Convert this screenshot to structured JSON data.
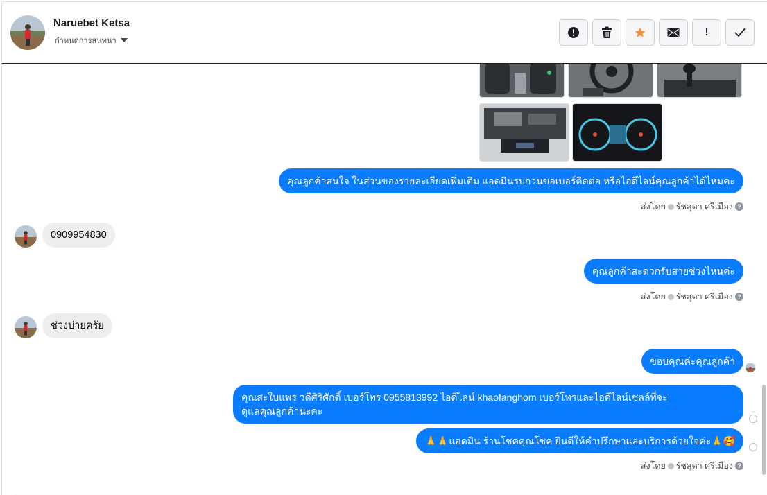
{
  "header": {
    "contact_name": "Naruebet Ketsa",
    "assign_label": "กำหนดการสนทนา",
    "toolbar": [
      {
        "name": "spam-button",
        "icon": "alert-circle-icon"
      },
      {
        "name": "delete-button",
        "icon": "trash-icon"
      },
      {
        "name": "star-button",
        "icon": "star-icon"
      },
      {
        "name": "mark-unread-button",
        "icon": "envelope-icon"
      },
      {
        "name": "follow-up-button",
        "icon": "exclamation-icon",
        "text": "!"
      },
      {
        "name": "mark-done-button",
        "icon": "checkmark-icon"
      }
    ]
  },
  "messages": {
    "m1": "คุณลูกค้าสนใจ ในส่วนของรายละเอียดเพิ่มเติม แอดมินรบกวนขอเบอร์ติดต่อ หรือไอดีไลน์คุณลูกค้าได้ไหมคะ",
    "m2": "0909954830",
    "m3": "คุณลูกค้าสะดวกรับสายช่วงไหนค่ะ",
    "m4": "ช่วงบ่ายครัย",
    "m5": "ขอบคุณค่ะคุณลูกค้า",
    "m6_line1": "คุณสะใบแพร วดีศิริศักดิ์ เบอร์โทร 0955813992  ไอดีไลน์  khaofanghom   เบอร์โทรและไอดีไลน์เซลล์ที่จะ",
    "m6_line2": "ดูแลคุณลูกค้านะคะ",
    "m7": "🙏🙏แอดมิน ร้านโชคคุณโชค ยินดีให้คำปรึกษาและบริการด้วยใจค่ะ🙏🥰"
  },
  "sent_by": {
    "prefix": "ส่งโดย",
    "agent": "รัชสุดา ศรีเมือง",
    "help": "?"
  },
  "colors": {
    "outgoing_bubble": "#0a7cff",
    "incoming_bubble": "#eeeeee",
    "star": "#f7923b"
  }
}
